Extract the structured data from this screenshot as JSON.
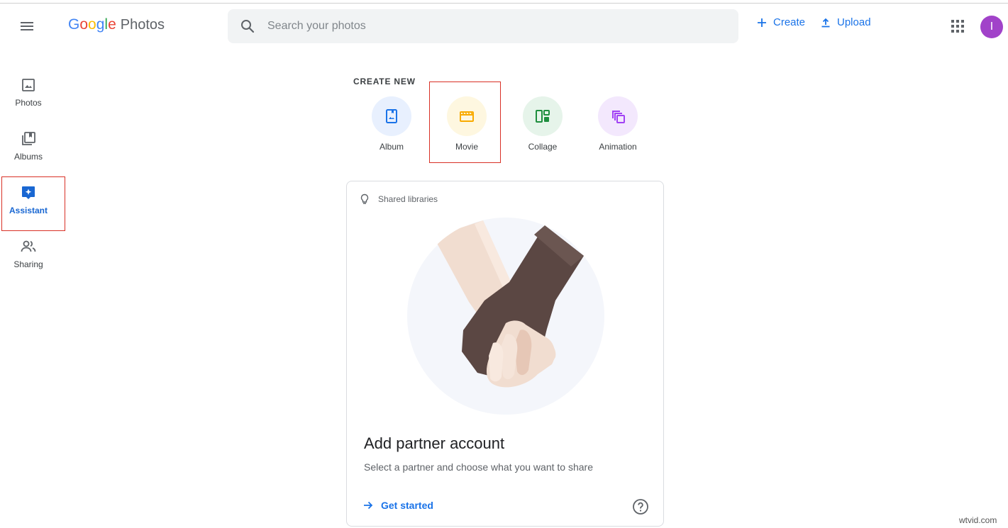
{
  "app": {
    "logo_letters": [
      "G",
      "o",
      "o",
      "g",
      "l",
      "e"
    ],
    "logo_colors": [
      "#4285f4",
      "#ea4335",
      "#fbbc05",
      "#4285f4",
      "#34a853",
      "#ea4335"
    ],
    "product": "Photos"
  },
  "header": {
    "search_placeholder": "Search your photos",
    "create_label": "Create",
    "upload_label": "Upload",
    "avatar_initial": "I",
    "avatar_color": "#a142c9",
    "accent_color": "#1a73e8"
  },
  "sidebar": {
    "items": [
      {
        "label": "Photos",
        "icon": "photo-icon"
      },
      {
        "label": "Albums",
        "icon": "albums-icon"
      },
      {
        "label": "Assistant",
        "icon": "assistant-icon",
        "active": true
      },
      {
        "label": "Sharing",
        "icon": "sharing-icon"
      }
    ]
  },
  "create_new": {
    "title": "CREATE NEW",
    "items": [
      {
        "label": "Album",
        "icon": "album-icon",
        "bg": "#e8f0fe",
        "color": "#1a73e8"
      },
      {
        "label": "Movie",
        "icon": "movie-icon",
        "bg": "#fef7e0",
        "color": "#f9ab00"
      },
      {
        "label": "Collage",
        "icon": "collage-icon",
        "bg": "#e6f4ea",
        "color": "#1e8e3e"
      },
      {
        "label": "Animation",
        "icon": "animation-icon",
        "bg": "#f3e8fd",
        "color": "#a142f4"
      }
    ]
  },
  "card": {
    "header": "Shared libraries",
    "title": "Add partner account",
    "description": "Select a partner and choose what you want to share",
    "cta": "Get started"
  },
  "watermark": "wtvid.com"
}
